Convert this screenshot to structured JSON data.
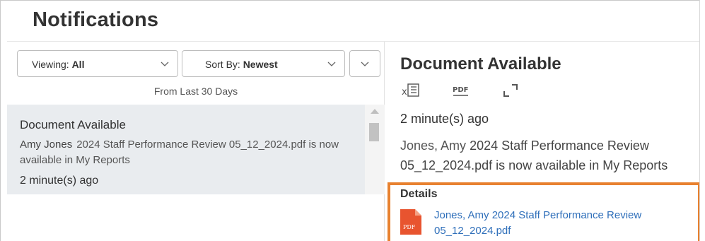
{
  "page": {
    "title": "Notifications"
  },
  "filters": {
    "viewing_prefix": "Viewing:",
    "viewing_value": "All",
    "sort_prefix": "Sort By:",
    "sort_value": "Newest",
    "range_note": "From Last 30 Days"
  },
  "notifications": [
    {
      "title": "Document Available",
      "person": "Amy Jones",
      "message": "2024 Staff Performance Review 05_12_2024.pdf is now available in My Reports",
      "time": "2 minute(s) ago"
    }
  ],
  "detail": {
    "title": "Document Available",
    "toolbar_icons": [
      "excel-export-icon",
      "pdf-export-icon",
      "expand-icon"
    ],
    "time": "2 minute(s) ago",
    "person": "Jones, Amy",
    "message": "2024 Staff Performance Review 05_12_2024.pdf is now available in My Reports",
    "details_heading": "Details",
    "file_person": "Jones, Amy",
    "file_name": "2024 Staff Performance Review 05_12_2024.pdf",
    "file_icon_label": "PDF"
  },
  "colors": {
    "highlight_border": "#e8812f",
    "selected_row_bg": "#e9ecef",
    "link": "#2f6fba",
    "pdf_icon": "#e8542f"
  }
}
